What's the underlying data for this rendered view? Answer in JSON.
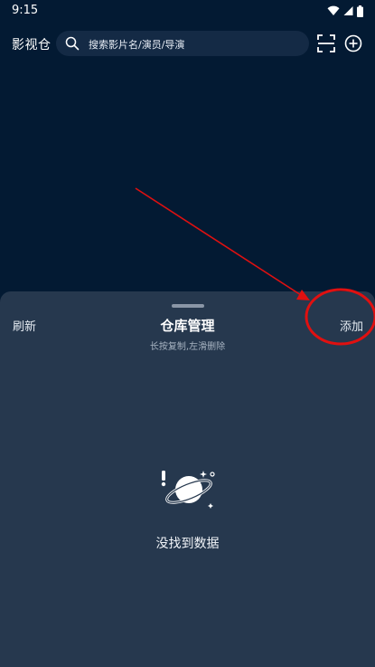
{
  "status_bar": {
    "time": "9:15",
    "icons": [
      "wifi-icon",
      "cellular-signal-icon",
      "battery-icon"
    ]
  },
  "top_bar": {
    "app_title": "影视仓",
    "search": {
      "placeholder": "搜索影片名/演员/导演",
      "icon": "search-icon"
    },
    "actions": [
      "scan-icon",
      "add-circle-icon"
    ]
  },
  "sheet": {
    "title": "仓库管理",
    "subtitle": "长按复制,左滑删除",
    "refresh_label": "刷新",
    "add_label": "添加",
    "empty_text": "没找到数据",
    "empty_icon": "planet-icon"
  },
  "colors": {
    "background": "#031a33",
    "sheet_background": "#26384e",
    "annotation": "#e01010"
  }
}
